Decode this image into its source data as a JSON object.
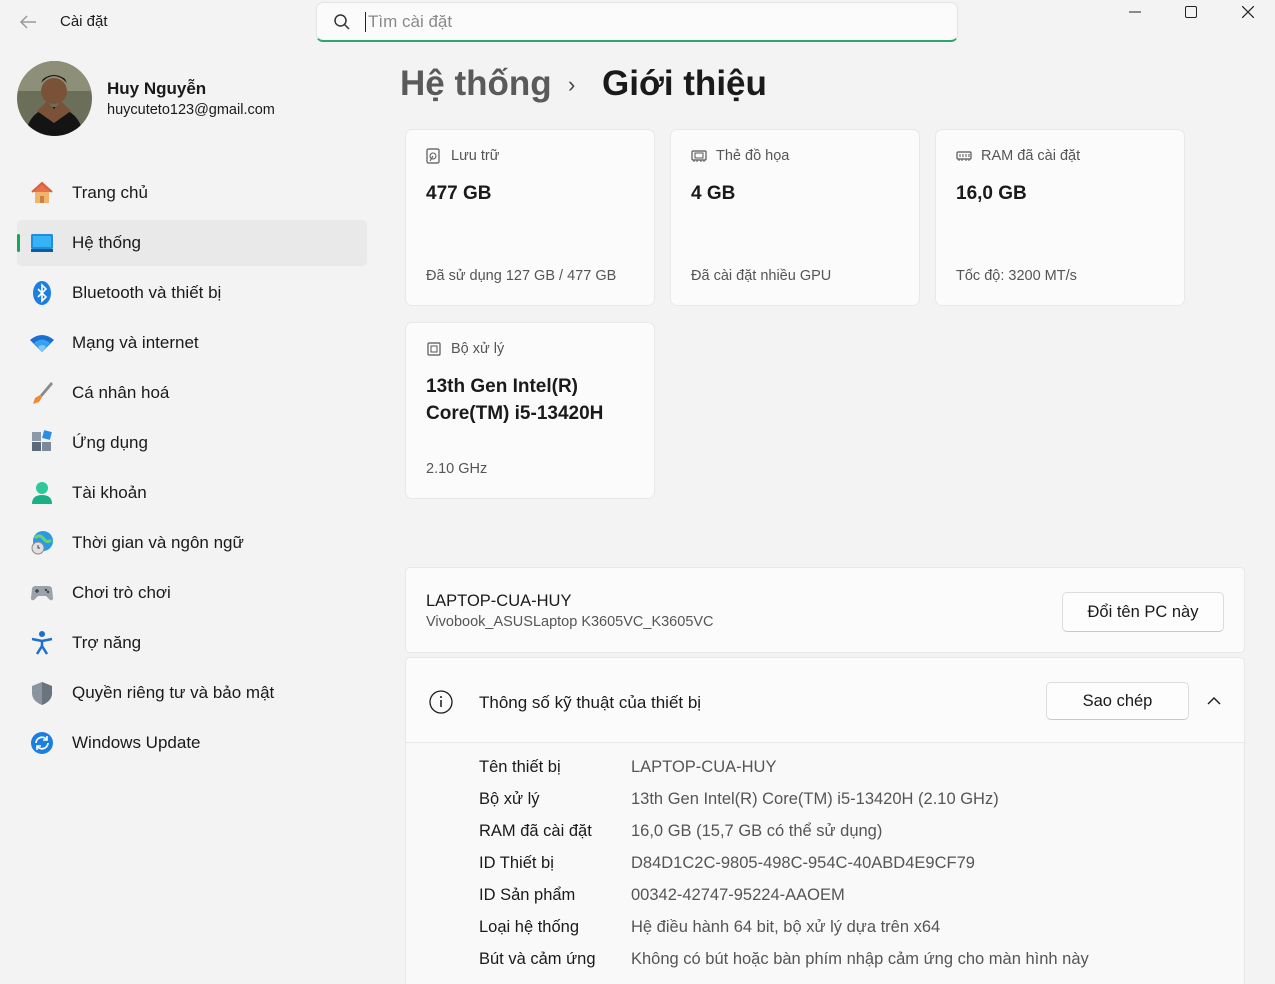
{
  "app": {
    "title": "Cài đặt"
  },
  "search": {
    "placeholder": "Tìm cài đặt"
  },
  "user": {
    "name": "Huy Nguyễn",
    "email": "huycuteto123@gmail.com"
  },
  "nav": {
    "items": [
      {
        "label": "Trang chủ",
        "icon": "home-icon"
      },
      {
        "label": "Hệ thống",
        "icon": "system-icon",
        "active": true
      },
      {
        "label": "Bluetooth và thiết bị",
        "icon": "bluetooth-icon"
      },
      {
        "label": "Mạng và internet",
        "icon": "wifi-icon"
      },
      {
        "label": "Cá nhân hoá",
        "icon": "brush-icon"
      },
      {
        "label": "Ứng dụng",
        "icon": "apps-icon"
      },
      {
        "label": "Tài khoản",
        "icon": "account-icon"
      },
      {
        "label": "Thời gian và ngôn ngữ",
        "icon": "globe-clock-icon"
      },
      {
        "label": "Chơi trò chơi",
        "icon": "gamepad-icon"
      },
      {
        "label": "Trợ năng",
        "icon": "accessibility-icon"
      },
      {
        "label": "Quyền riêng tư và bảo mật",
        "icon": "shield-icon"
      },
      {
        "label": "Windows Update",
        "icon": "update-icon"
      }
    ]
  },
  "breadcrumb": {
    "parent": "Hệ thống",
    "separator": "›",
    "current": "Giới thiệu"
  },
  "cards": {
    "storage": {
      "label": "Lưu trữ",
      "value": "477 GB",
      "sub": "Đã sử dụng 127 GB / 477 GB"
    },
    "gpu": {
      "label": "Thẻ đồ họa",
      "value": "4 GB",
      "sub": "Đã cài đặt nhiều GPU"
    },
    "ram": {
      "label": "RAM đã cài đặt",
      "value": "16,0 GB",
      "sub": "Tốc độ: 3200 MT/s"
    },
    "cpu": {
      "label": "Bộ xử lý",
      "value_line1": "13th Gen Intel(R)",
      "value_line2": "Core(TM) i5-13420H",
      "sub": "2.10 GHz"
    }
  },
  "device": {
    "name": "LAPTOP-CUA-HUY",
    "model": "Vivobook_ASUSLaptop K3605VC_K3605VC",
    "rename_label": "Đổi tên PC này"
  },
  "specs": {
    "title": "Thông số kỹ thuật của thiết bị",
    "copy_label": "Sao chép",
    "rows": [
      {
        "label": "Tên thiết bị",
        "value": "LAPTOP-CUA-HUY"
      },
      {
        "label": "Bộ xử lý",
        "value": "13th Gen Intel(R) Core(TM) i5-13420H (2.10 GHz)"
      },
      {
        "label": "RAM đã cài đặt",
        "value": "16,0 GB (15,7 GB có thể sử dụng)"
      },
      {
        "label": "ID Thiết bị",
        "value": "D84D1C2C-9805-498C-954C-40ABD4E9CF79"
      },
      {
        "label": "ID Sản phẩm",
        "value": "00342-42747-95224-AAOEM"
      },
      {
        "label": "Loại hệ thống",
        "value": "Hệ điều hành 64 bit, bộ xử lý dựa trên x64"
      },
      {
        "label": "Bút và cảm ứng",
        "value": "Không có bút hoặc bàn phím nhập cảm ứng cho màn hình này"
      }
    ]
  },
  "colors": {
    "accent": "#1aa35a",
    "background": "#f3f3f3",
    "card": "#fbfbfb"
  }
}
